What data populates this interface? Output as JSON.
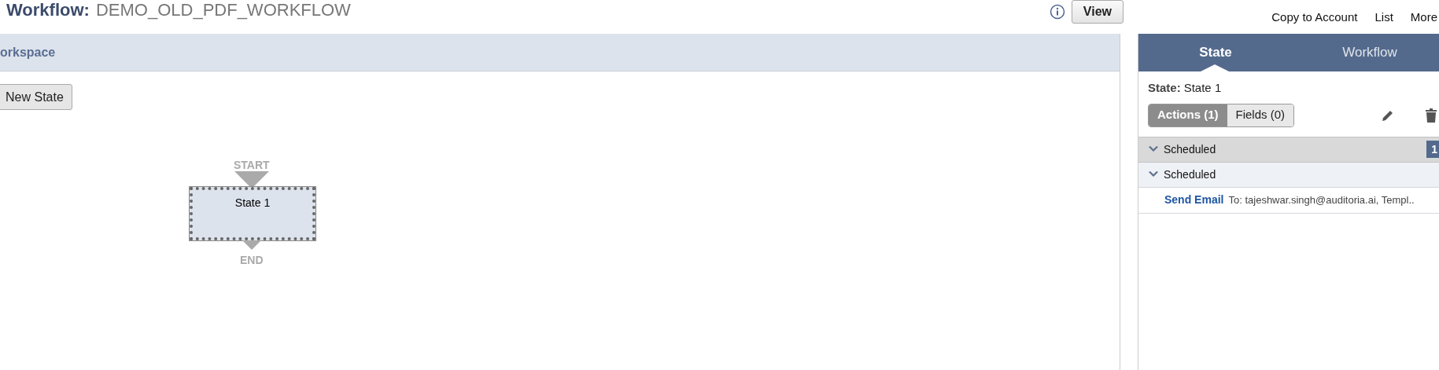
{
  "header": {
    "label": "Workflow:",
    "name": "DEMO_OLD_PDF_WORKFLOW",
    "view_button": "View",
    "links": [
      "Copy to Account",
      "List",
      "More"
    ]
  },
  "workspace": {
    "title": "orkspace",
    "new_state_button": "New State",
    "diagram": {
      "start_label": "START",
      "end_label": "END",
      "states": [
        {
          "name": "State 1",
          "selected": true
        }
      ]
    }
  },
  "side_panel": {
    "tabs": [
      {
        "label": "State",
        "selected": true
      },
      {
        "label": "Workflow",
        "selected": false
      }
    ],
    "state_label": "State:",
    "state_name": "State 1",
    "segments": [
      {
        "label": "Actions (1)",
        "selected": true
      },
      {
        "label": "Fields (0)",
        "selected": false
      }
    ],
    "rows": [
      {
        "kind": "group",
        "label": "Scheduled",
        "expanded": true,
        "badge": "1"
      },
      {
        "kind": "subgroup",
        "label": "Scheduled",
        "expanded": true
      },
      {
        "kind": "action",
        "label": "Send Email",
        "detail": "To: tajeshwar.singh@auditoria.ai, Templ.."
      }
    ]
  }
}
